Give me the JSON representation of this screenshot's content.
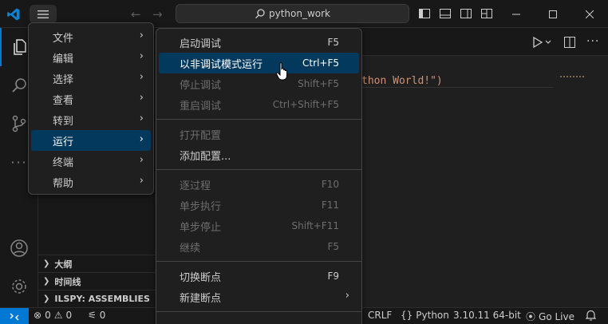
{
  "titlebar": {
    "search_text": "python_work"
  },
  "sidebar": {
    "sections": [
      {
        "label": "大纲"
      },
      {
        "label": "时间线"
      },
      {
        "label": "ILSPY: ASSEMBLIES"
      }
    ]
  },
  "editor": {
    "code_visible": "thon World!\")"
  },
  "menu_main": {
    "items": [
      {
        "label": "文件"
      },
      {
        "label": "编辑"
      },
      {
        "label": "选择"
      },
      {
        "label": "查看"
      },
      {
        "label": "转到"
      },
      {
        "label": "运行"
      },
      {
        "label": "终端"
      },
      {
        "label": "帮助"
      }
    ]
  },
  "menu_run": {
    "items": [
      {
        "label": "启动调试",
        "key": "F5"
      },
      {
        "label": "以非调试模式运行",
        "key": "Ctrl+F5"
      },
      {
        "label": "停止调试",
        "key": "Shift+F5"
      },
      {
        "label": "重启调试",
        "key": "Ctrl+Shift+F5"
      },
      {
        "label": "打开配置",
        "key": ""
      },
      {
        "label": "添加配置...",
        "key": ""
      },
      {
        "label": "逐过程",
        "key": "F10"
      },
      {
        "label": "单步执行",
        "key": "F11"
      },
      {
        "label": "单步停止",
        "key": "Shift+F11"
      },
      {
        "label": "继续",
        "key": "F5"
      },
      {
        "label": "切换断点",
        "key": "F9"
      },
      {
        "label": "新建断点",
        "key": ""
      }
    ]
  },
  "statusbar": {
    "errors": "0",
    "warnings": "0",
    "ports": "0",
    "eol": "CRLF",
    "language": "Python",
    "interpreter": "3.10.11 64-bit",
    "go_live": "Go Live"
  },
  "colors": {
    "accent": "#0078d4",
    "menu_highlight": "#04395e",
    "string": "#ce9178"
  }
}
